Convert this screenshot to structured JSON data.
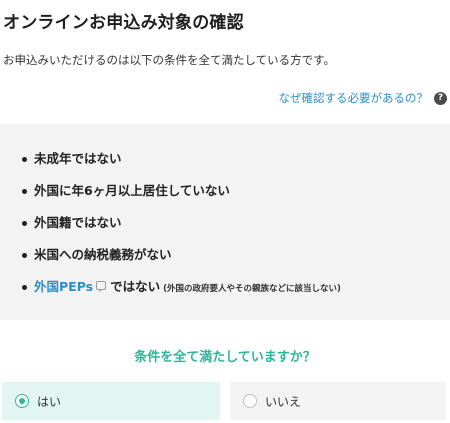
{
  "page": {
    "title": "オンラインお申込み対象の確認",
    "intro": "お申込みいただけるのは以下の条件を全て満たしている方です。"
  },
  "help": {
    "link_text": "なぜ確認する必要があるの？",
    "icon_glyph": "?"
  },
  "conditions": {
    "items": [
      "未成年ではない",
      "外国に年6ヶ月以上居住していない",
      "外国籍ではない",
      "米国への納税義務がない"
    ],
    "peps": {
      "term": "外国PEPs",
      "suffix": "ではない",
      "note": "(外国の政府要人やその親族などに該当しない)"
    }
  },
  "question": {
    "text": "条件を全て満たしていますか？",
    "options": [
      {
        "label": "はい",
        "selected": true
      },
      {
        "label": "いいえ",
        "selected": false
      }
    ]
  },
  "colors": {
    "accent": "#2fb59a",
    "link": "#2b8fc8",
    "panel_bg": "#f3f3f3",
    "selected_bg": "#e3f5f1"
  }
}
